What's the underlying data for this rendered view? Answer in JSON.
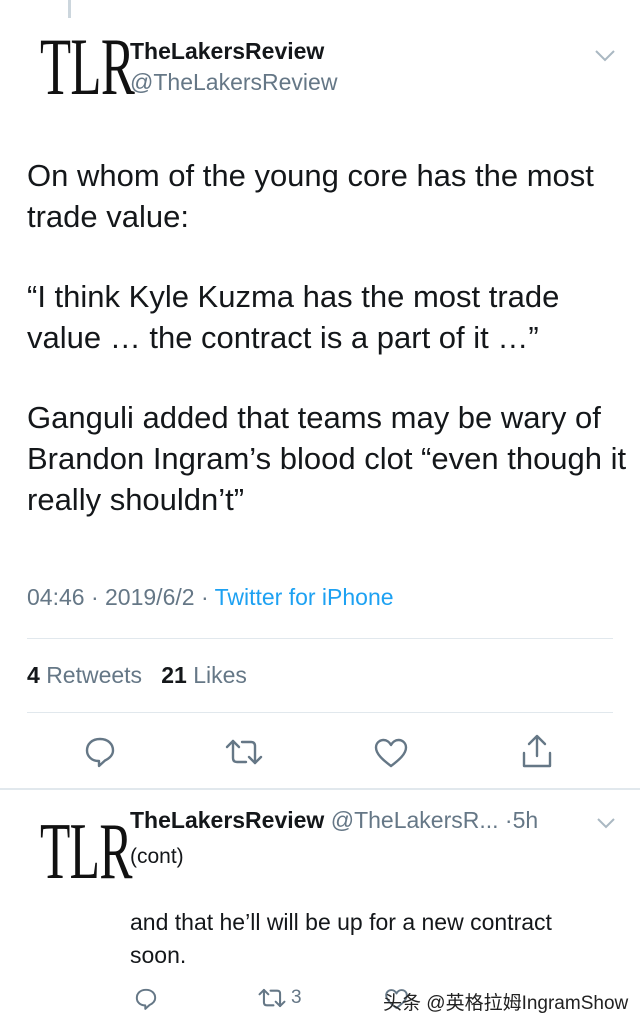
{
  "tweet": {
    "logo_text": "TLR",
    "display_name": "TheLakersReview",
    "handle": "@TheLakersReview",
    "paragraphs": [
      "On whom of the young core has the most trade value:",
      "“I think Kyle Kuzma has the most trade value … the contract is a part of it …”",
      "Ganguli added that teams may be wary of Brandon Ingram’s blood clot “even though it really shouldn’t”"
    ],
    "time": "04:46",
    "date": "2019/6/2",
    "source": "Twitter for iPhone",
    "retweets_count": "4",
    "retweets_label": "Retweets",
    "likes_count": "21",
    "likes_label": "Likes"
  },
  "reply": {
    "logo_text": "TLR",
    "display_name": "TheLakersReview",
    "handle": "@TheLakersR...",
    "age": "5h",
    "subtitle": "(cont)",
    "text": "and that he’ll will be up for a new contract soon.",
    "retweet_count": "3"
  },
  "watermark": "头条 @英格拉姆IngramShow",
  "colors": {
    "link": "#1da1f2",
    "muted": "#657786",
    "divider": "#e1e8ed"
  }
}
